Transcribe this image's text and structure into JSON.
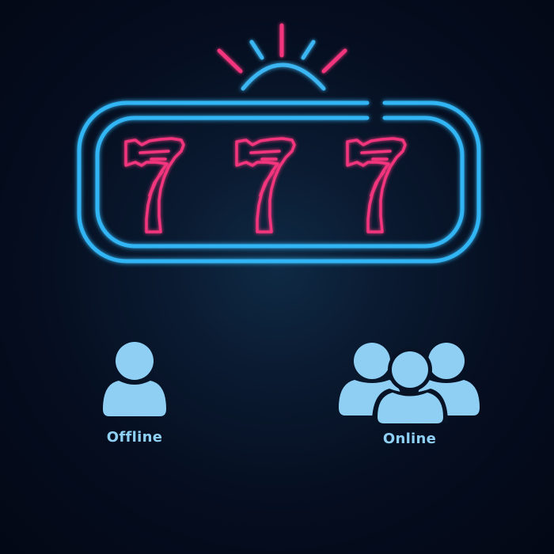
{
  "logo": {
    "reel_symbols": [
      "7",
      "7",
      "7"
    ],
    "frame_color": "#33b5f5",
    "symbol_color": "#f2357c",
    "rays_color_center": "#f2357c",
    "rays_color_side": "#3bb6f2"
  },
  "modes": {
    "offline": {
      "label": "Offline",
      "icon": "single-user-icon"
    },
    "online": {
      "label": "Online",
      "icon": "user-group-icon"
    }
  },
  "colors": {
    "icon_fill": "#8ecff3",
    "label": "#8fd0f5",
    "background": "#050d1f"
  }
}
